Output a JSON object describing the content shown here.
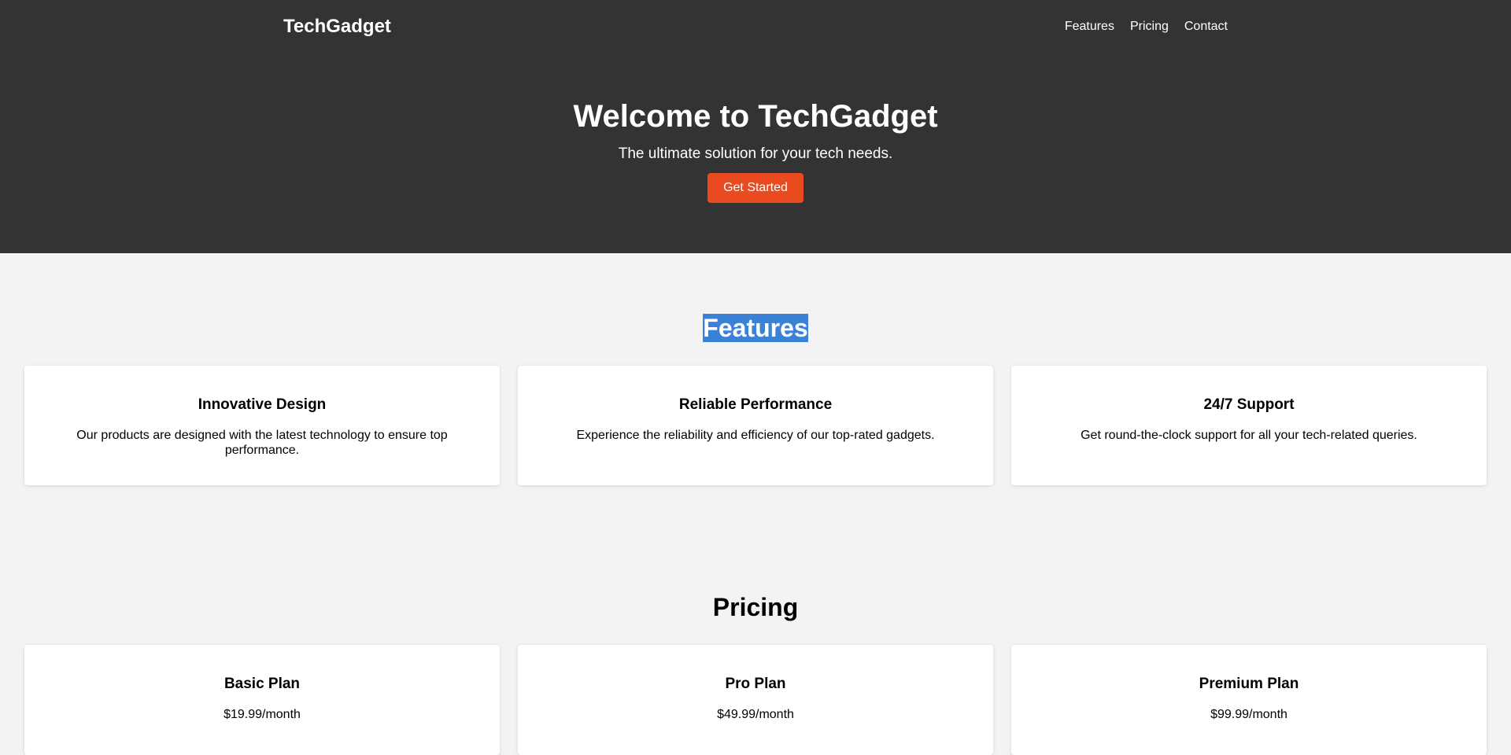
{
  "brand": "TechGadget",
  "nav": [
    "Features",
    "Pricing",
    "Contact"
  ],
  "hero": {
    "title": "Welcome to TechGadget",
    "subtitle": "The ultimate solution for your tech needs.",
    "cta": "Get Started"
  },
  "features": {
    "heading": "Features",
    "items": [
      {
        "title": "Innovative Design",
        "text": "Our products are designed with the latest technology to ensure top performance."
      },
      {
        "title": "Reliable Performance",
        "text": "Experience the reliability and efficiency of our top-rated gadgets."
      },
      {
        "title": "24/7 Support",
        "text": "Get round-the-clock support for all your tech-related queries."
      }
    ]
  },
  "pricing": {
    "heading": "Pricing",
    "plans": [
      {
        "name": "Basic Plan",
        "price": "$19.99/month"
      },
      {
        "name": "Pro Plan",
        "price": "$49.99/month"
      },
      {
        "name": "Premium Plan",
        "price": "$99.99/month"
      }
    ]
  },
  "colors": {
    "header_bg": "#333333",
    "accent": "#e94a1f",
    "selection": "#3b82d6",
    "page_bg": "#f3f3f3"
  }
}
